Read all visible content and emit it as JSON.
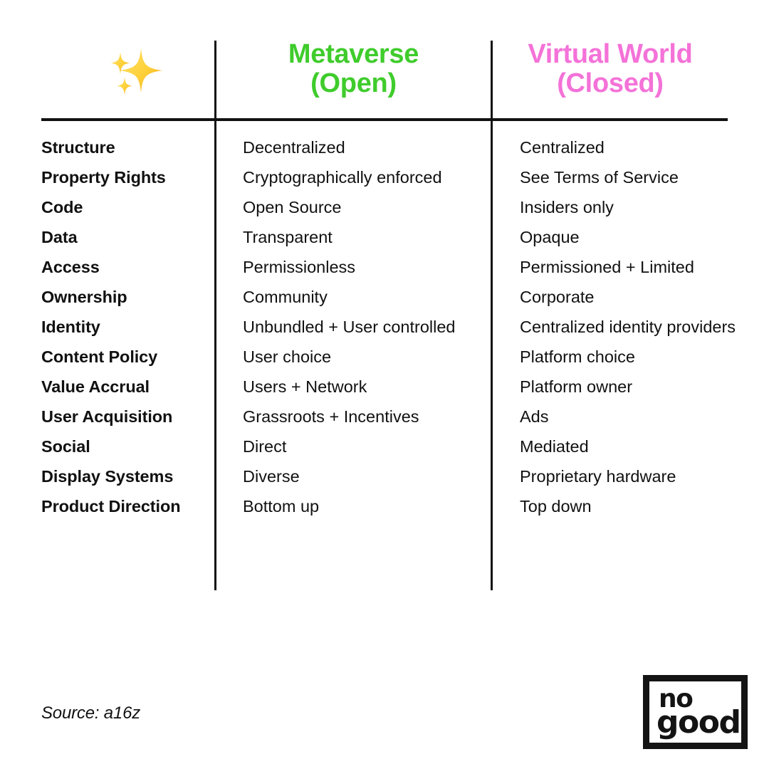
{
  "header": {
    "spark_icon": "sparkles-icon",
    "columns": [
      {
        "label": "",
        "icon": "sparkles-icon"
      },
      {
        "label": "Metaverse\n(Open)",
        "color": "#3fcc2c"
      },
      {
        "label": "Virtual World\n(Closed)",
        "color": "#f472d8"
      }
    ]
  },
  "comparison": {
    "column_headers": [
      "",
      "Metaverse (Open)",
      "Virtual World (Closed)"
    ],
    "rows": [
      {
        "label": "Structure",
        "open": "Decentralized",
        "closed": "Centralized"
      },
      {
        "label": "Property Rights",
        "open": "Cryptographically enforced",
        "closed": "See Terms of Service"
      },
      {
        "label": "Code",
        "open": "Open Source",
        "closed": "Insiders only"
      },
      {
        "label": "Data",
        "open": "Transparent",
        "closed": "Opaque"
      },
      {
        "label": "Access",
        "open": "Permissionless",
        "closed": "Permissioned + Limited"
      },
      {
        "label": "Ownership",
        "open": "Community",
        "closed": "Corporate"
      },
      {
        "label": "Identity",
        "open": "Unbundled + User controlled",
        "closed": "Centralized identity providers"
      },
      {
        "label": "Content Policy",
        "open": "User choice",
        "closed": "Platform choice"
      },
      {
        "label": "Value Accrual",
        "open": "Users + Network",
        "closed": "Platform owner"
      },
      {
        "label": "User Acquisition",
        "open": "Grassroots + Incentives",
        "closed": "Ads"
      },
      {
        "label": "Social",
        "open": "Direct",
        "closed": "Mediated"
      },
      {
        "label": "Display Systems",
        "open": "Diverse",
        "closed": "Proprietary hardware"
      },
      {
        "label": "Product Direction",
        "open": "Bottom up",
        "closed": "Top down"
      }
    ]
  },
  "footer": {
    "source": "Source: a16z",
    "logo": {
      "line1": "no",
      "line2": "good"
    }
  },
  "colors": {
    "background": "#ffffff",
    "text": "#111111",
    "metaverse_green": "#3fcc2c",
    "virtual_world_pink": "#f472d8",
    "rule": "#111111",
    "sparkle_yellow": "#fcc93b"
  }
}
